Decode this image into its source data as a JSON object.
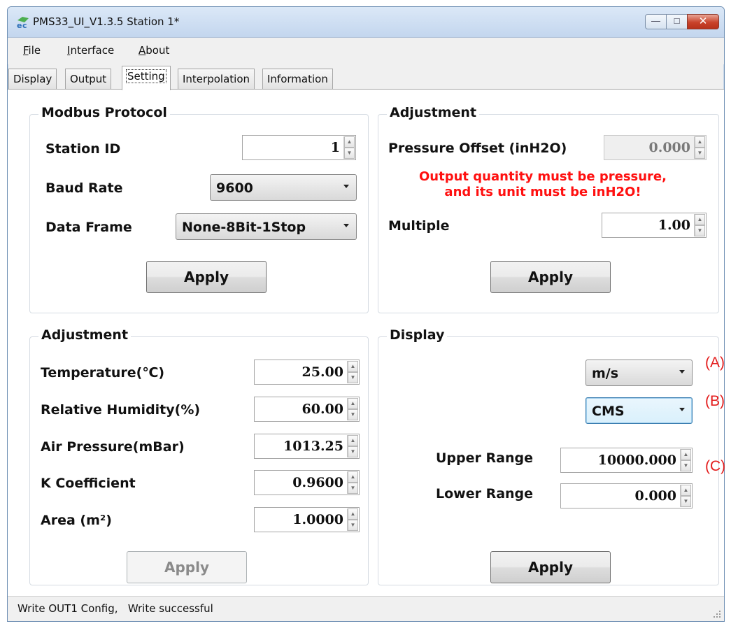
{
  "window": {
    "title": "PMS33_UI_V1.3.5  Station 1*",
    "controls": {
      "minimize": "—",
      "maximize": "□",
      "close": "✕"
    }
  },
  "menu": [
    "File",
    "Interface",
    "About"
  ],
  "tabs": [
    "Display",
    "Output",
    "Setting",
    "Interpolation",
    "Information"
  ],
  "active_tab": "Setting",
  "modbus": {
    "title": "Modbus Protocol",
    "station_id_label": "Station ID",
    "station_id": "1",
    "baud_rate_label": "Baud Rate",
    "baud_rate": "9600",
    "data_frame_label": "Data Frame",
    "data_frame": "None-8Bit-1Stop",
    "apply": "Apply"
  },
  "adjust_top": {
    "title": "Adjustment",
    "pressure_offset_label": "Pressure Offset  (inH2O)",
    "pressure_offset": "0.000",
    "warning_line1": "Output quantity must be pressure,",
    "warning_line2": "and its unit must be inH2O!",
    "multiple_label": "Multiple",
    "multiple": "1.00",
    "apply": "Apply"
  },
  "adjust_bottom": {
    "title": "Adjustment",
    "rows": [
      {
        "label": "Temperature(℃)",
        "value": "25.00"
      },
      {
        "label": "Relative Humidity(%)",
        "value": "60.00"
      },
      {
        "label": "Air Pressure(mBar)",
        "value": "1013.25"
      },
      {
        "label": "K Coefficient",
        "value": "0.9600"
      },
      {
        "label": "Area (m²)",
        "value": "1.0000"
      }
    ],
    "apply": "Apply"
  },
  "display": {
    "title": "Display",
    "unit_select": "m/s",
    "flow_select": "CMS",
    "upper_range_label": "Upper Range",
    "upper_range": "10000.000",
    "lower_range_label": "Lower Range",
    "lower_range": "0.000",
    "apply": "Apply",
    "annotations": [
      "(A)",
      "(B)",
      "(C)"
    ]
  },
  "status": "Write OUT1 Config,   Write successful",
  "colors": {
    "warning": "#ff1010",
    "annotation": "#e31b1b",
    "focus": "#3c7fb1"
  }
}
